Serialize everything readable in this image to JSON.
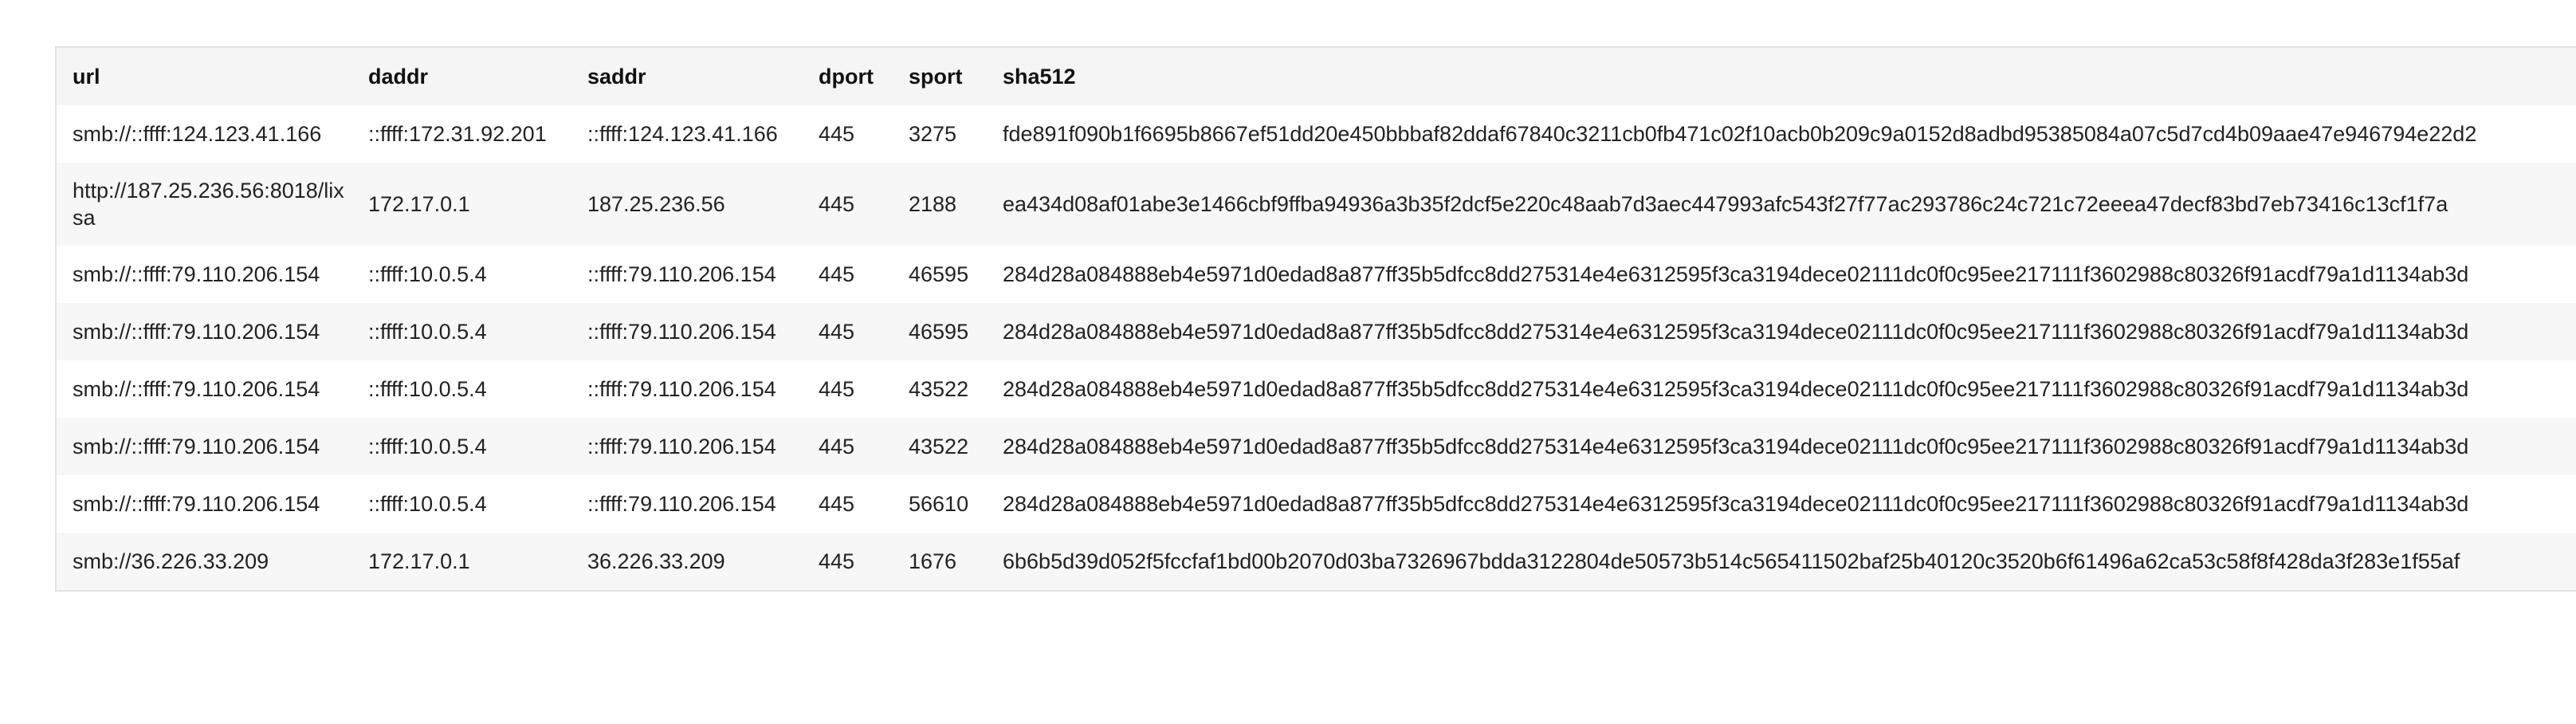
{
  "table": {
    "columns": [
      "url",
      "daddr",
      "saddr",
      "dport",
      "sport",
      "sha512"
    ],
    "rows": [
      {
        "url": "smb://::ffff:124.123.41.166",
        "daddr": "::ffff:172.31.92.201",
        "saddr": "::ffff:124.123.41.166",
        "dport": "445",
        "sport": "3275",
        "sha512": "fde891f090b1f6695b8667ef51dd20e450bbbaf82ddaf67840c3211cb0fb471c02f10acb0b209c9a0152d8adbd95385084a07c5d7cd4b09aae47e946794e22d2"
      },
      {
        "url": "http://187.25.236.56:8018/lixsa",
        "daddr": "172.17.0.1",
        "saddr": "187.25.236.56",
        "dport": "445",
        "sport": "2188",
        "sha512": "ea434d08af01abe3e1466cbf9ffba94936a3b35f2dcf5e220c48aab7d3aec447993afc543f27f77ac293786c24c721c72eeea47decf83bd7eb73416c13cf1f7a"
      },
      {
        "url": "smb://::ffff:79.110.206.154",
        "daddr": "::ffff:10.0.5.4",
        "saddr": "::ffff:79.110.206.154",
        "dport": "445",
        "sport": "46595",
        "sha512": "284d28a084888eb4e5971d0edad8a877ff35b5dfcc8dd275314e4e6312595f3ca3194dece02111dc0f0c95ee217111f3602988c80326f91acdf79a1d1134ab3d"
      },
      {
        "url": "smb://::ffff:79.110.206.154",
        "daddr": "::ffff:10.0.5.4",
        "saddr": "::ffff:79.110.206.154",
        "dport": "445",
        "sport": "46595",
        "sha512": "284d28a084888eb4e5971d0edad8a877ff35b5dfcc8dd275314e4e6312595f3ca3194dece02111dc0f0c95ee217111f3602988c80326f91acdf79a1d1134ab3d"
      },
      {
        "url": "smb://::ffff:79.110.206.154",
        "daddr": "::ffff:10.0.5.4",
        "saddr": "::ffff:79.110.206.154",
        "dport": "445",
        "sport": "43522",
        "sha512": "284d28a084888eb4e5971d0edad8a877ff35b5dfcc8dd275314e4e6312595f3ca3194dece02111dc0f0c95ee217111f3602988c80326f91acdf79a1d1134ab3d"
      },
      {
        "url": "smb://::ffff:79.110.206.154",
        "daddr": "::ffff:10.0.5.4",
        "saddr": "::ffff:79.110.206.154",
        "dport": "445",
        "sport": "43522",
        "sha512": "284d28a084888eb4e5971d0edad8a877ff35b5dfcc8dd275314e4e6312595f3ca3194dece02111dc0f0c95ee217111f3602988c80326f91acdf79a1d1134ab3d"
      },
      {
        "url": "smb://::ffff:79.110.206.154",
        "daddr": "::ffff:10.0.5.4",
        "saddr": "::ffff:79.110.206.154",
        "dport": "445",
        "sport": "56610",
        "sha512": "284d28a084888eb4e5971d0edad8a877ff35b5dfcc8dd275314e4e6312595f3ca3194dece02111dc0f0c95ee217111f3602988c80326f91acdf79a1d1134ab3d"
      },
      {
        "url": "smb://36.226.33.209",
        "daddr": "172.17.0.1",
        "saddr": "36.226.33.209",
        "dport": "445",
        "sport": "1676",
        "sha512": "6b6b5d39d052f5fccfaf1bd00b2070d03ba7326967bdda3122804de50573b514c565411502baf25b40120c3520b6f61496a62ca53c58f8f428da3f283e1f55af"
      }
    ]
  }
}
